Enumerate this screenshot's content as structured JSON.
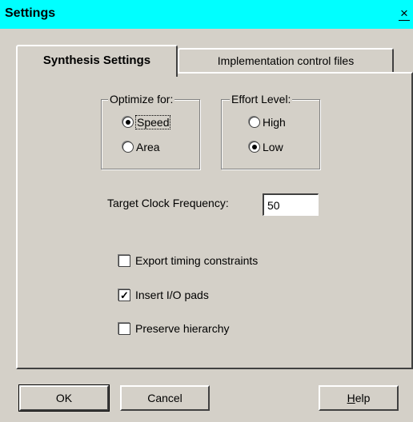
{
  "window": {
    "title": "Settings",
    "close_symbol": "×"
  },
  "tabs": [
    {
      "label": "Synthesis Settings",
      "active": true
    },
    {
      "label": "Implementation control files",
      "active": false
    }
  ],
  "optimize": {
    "legend": "Optimize for:",
    "options": [
      {
        "label": "Speed",
        "selected": true
      },
      {
        "label": "Area",
        "selected": false
      }
    ]
  },
  "effort": {
    "legend": "Effort Level:",
    "options": [
      {
        "label": "High",
        "selected": false
      },
      {
        "label": "Low",
        "selected": true
      }
    ]
  },
  "frequency": {
    "label": "Target Clock Frequency:",
    "value": "50"
  },
  "checkboxes": [
    {
      "label": "Export timing constraints",
      "checked": false
    },
    {
      "label": "Insert I/O pads",
      "checked": true
    },
    {
      "label": "Preserve hierarchy",
      "checked": false
    }
  ],
  "buttons": {
    "ok": "OK",
    "cancel": "Cancel",
    "help_first": "H",
    "help_rest": "elp"
  },
  "check_mark": "✓"
}
